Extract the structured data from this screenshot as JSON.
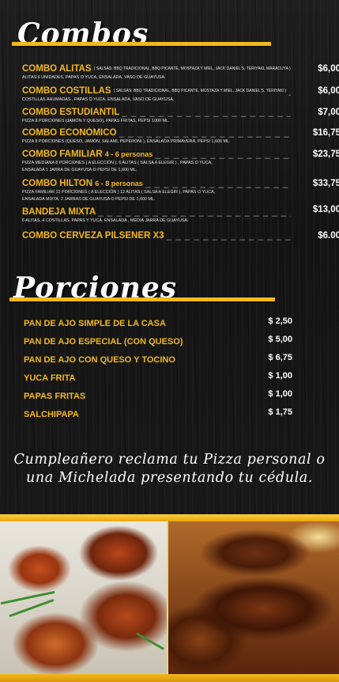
{
  "combos_section": {
    "title": "Combos",
    "items": [
      {
        "name": "COMBO ALITAS",
        "inline_desc": "( SALSAS: BBQ TRADICIONAL, BBQ PICANTE, MOSTAZA Y MIEL, JACK DANIEL'S, TERIYAKI, MARACUYA )",
        "people": "",
        "dashes": "__",
        "price": "$6,00",
        "desc_lines": [
          "ALITAS 6 UNIDADES, PAPAS O YUCA, ENSALADA, VASO DE GUAYUSA."
        ]
      },
      {
        "name": "COMBO COSTILLAS",
        "inline_desc": "( SALSAS: BBQ TRADICIONAL, BBQ PICANTE, MOSTAZA Y MIEL, JACK DANIEL'S, TERIYAKI )",
        "people": "",
        "dashes": "__",
        "price": "$6,00",
        "desc_lines": [
          "COSTILLAS AHUMADAS , PAPAS O YUCA, ENSALADA, VASO DE GUAYUSA."
        ]
      },
      {
        "name": "COMBO ESTUDIANTIL",
        "inline_desc": "",
        "people": "",
        "dashes": "_ _ _ _ _ _ _ _ _ _ _ _ _ _ _ _ _ _ _ _ _ _ _ _",
        "price": "$7,00",
        "desc_lines": [
          "PIZZA 8 PORCIONES (JAMÓN Y QUESO), PAPAS FRITAS, PEPSI 1000 ML."
        ]
      },
      {
        "name": "COMBO ECONÓMICO",
        "inline_desc": "",
        "people": "",
        "dashes": "_ _ _ _ _ _ _ _ _ _ _ _ _ _ _ _ _ _ _ _ _ _ _ _ _",
        "price": "$16,75",
        "desc_lines": [
          "PIZZA 8 PORCIONES (QUESO, JAMÓN, SALAMI, PEPERONI ), ENSALADA PRIMAVERA, PEPSI 1,600 ML."
        ]
      },
      {
        "name": "COMBO FAMILIAR",
        "inline_desc": "",
        "people": "4 - 6 personas",
        "dashes": "_ _ _ _ _ _ _ _ _ _ _ _ _ _ _",
        "price": "$23,75",
        "desc_lines": [
          "PIZZA MEDIANA 8 PORCIONES ( A ELECCIÓN ), 6 ALITAS ( SALSA A ELEGIR ) , PAPAS O YUCA,",
          "ENSALADA 1 JARRA DE GUAYUSA O PEPSI DE 1,600 ML."
        ]
      },
      {
        "name": "COMBO HILTON",
        "inline_desc": "",
        "people": "6 - 8 personas",
        "dashes": "_ _ _ _ _ _ _ _ _ _ _ _ _ _ _ _ _ _",
        "price": "$33,75",
        "desc_lines": [
          "PIZZA FAMILIAR 12 PORCIONES ( A ELECCIÓN ) 12 ALITAS ( SALSA A ELEGIR ), PAPAS O YUCA,",
          "ENSALADA MIXTA, 2 JARRAS DE GUAYUSA O PEPSI DE 1,600 ML."
        ]
      },
      {
        "name": "BANDEJA MIXTA",
        "inline_desc": "",
        "people": "",
        "dashes": "_ _ _ _ _ _ _ _ _ _ _ _ _ _ _ _ _ _ _ _ _ _ _ _ _ _ _",
        "price": "$13,00",
        "desc_lines": [
          "6 ALITAS, 4 COSTILLAS, PAPAS Y YUCA, ENSALADA , MEDIA JARRA DE GUAYUSA."
        ]
      },
      {
        "name": "COMBO CERVEZA PILSENER X3",
        "inline_desc": "",
        "people": "",
        "dashes": "_ _ _ _ _ _ _ _ _ _ _ _ _ _ _ _ _",
        "price": "$6.00",
        "desc_lines": []
      }
    ]
  },
  "porciones_section": {
    "title": "Porciones",
    "items": [
      {
        "name": "PAN DE AJO SIMPLE DE LA CASA",
        "price": "$ 2,50"
      },
      {
        "name": "PAN DE AJO ESPECIAL (CON QUESO)",
        "price": "$ 5,00"
      },
      {
        "name": "PAN DE AJO CON QUESO Y TOCINO",
        "price": "$ 6,75"
      },
      {
        "name": "YUCA FRITA",
        "price": "$ 1,00"
      },
      {
        "name": "PAPAS FRITAS",
        "price": "$ 1,00"
      },
      {
        "name": "SALCHIPAPA",
        "price": "$ 1,75"
      }
    ]
  },
  "promo": {
    "line1": "Cumpleañero reclama tu Pizza personal o",
    "line2": "una Michelada presentando tu cédula."
  },
  "colors": {
    "accent_gold": "#f2b81d",
    "background": "#181818",
    "text": "#ffffff"
  }
}
